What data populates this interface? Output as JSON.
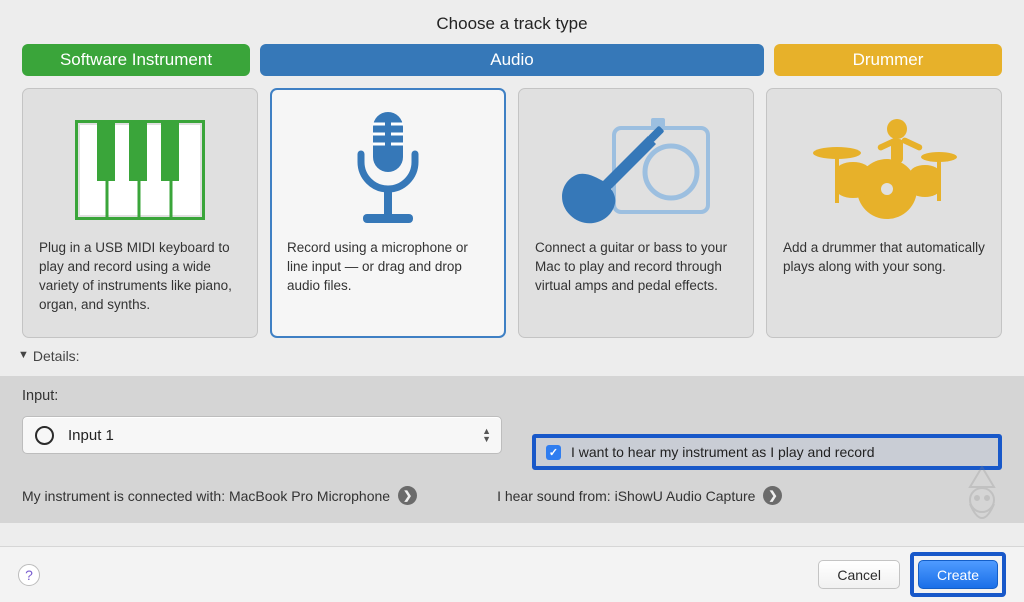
{
  "title": "Choose a track type",
  "tabs": {
    "software": "Software Instrument",
    "audio": "Audio",
    "drummer": "Drummer"
  },
  "cards": {
    "software": "Plug in a USB MIDI keyboard to play and record using a wide variety of instruments like piano, organ, and synths.",
    "mic": "Record using a microphone or line input — or drag and drop audio files.",
    "guitar": "Connect a guitar or bass to your Mac to play and record through virtual amps and pedal effects.",
    "drummer": "Add a drummer that automatically plays along with your song."
  },
  "details_label": "Details:",
  "input_label": "Input:",
  "input_value": "Input 1",
  "monitor_label": "I want to hear my instrument as I play and record",
  "connected_prefix": "My instrument is connected with: ",
  "connected_value": "MacBook Pro Microphone",
  "hear_prefix": "I hear sound from: ",
  "hear_value": "iShowU Audio Capture",
  "cancel": "Cancel",
  "create": "Create",
  "help": "?"
}
